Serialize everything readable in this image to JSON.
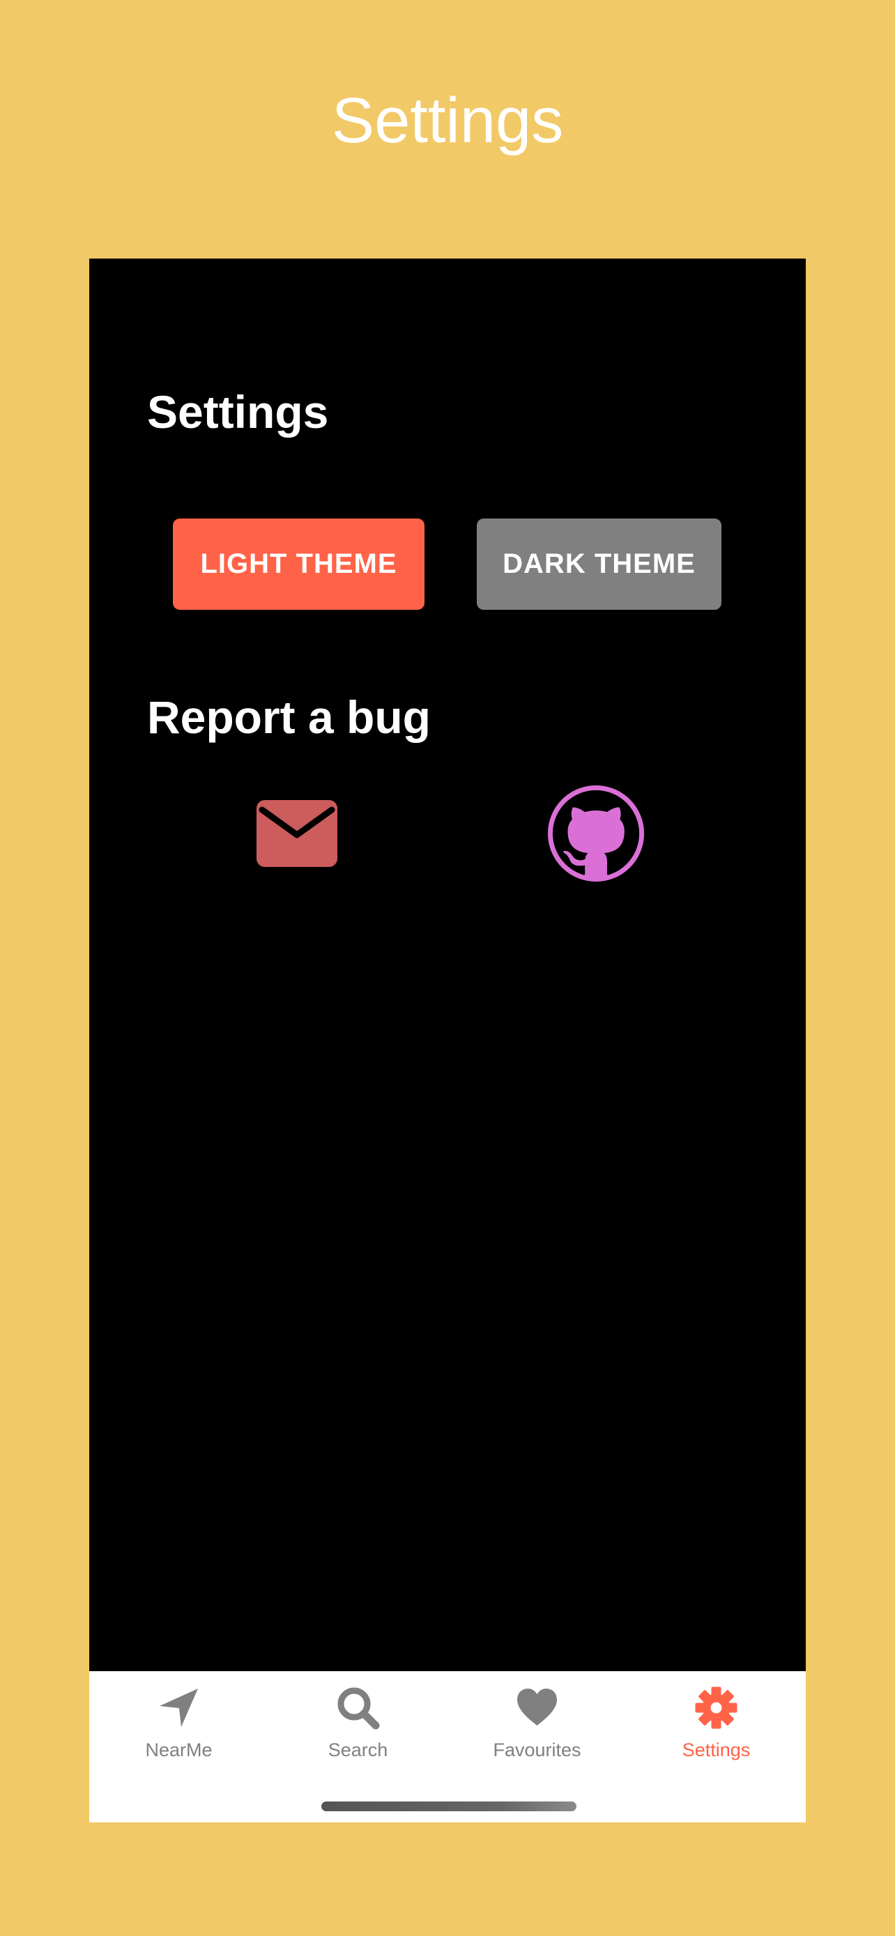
{
  "page_title": "Settings",
  "screen": {
    "heading": "Settings",
    "theme_buttons": {
      "light_label": "LIGHT THEME",
      "dark_label": "DARK THEME"
    },
    "report_heading": "Report a bug",
    "report_links": [
      {
        "icon": "mail-icon",
        "color": "#CD5C5C"
      },
      {
        "icon": "github-icon",
        "color": "#DA70D6"
      }
    ]
  },
  "tabbar": {
    "items": [
      {
        "label": "NearMe",
        "icon": "navigation-arrow-icon",
        "active": false
      },
      {
        "label": "Search",
        "icon": "search-icon",
        "active": false
      },
      {
        "label": "Favourites",
        "icon": "heart-icon",
        "active": false
      },
      {
        "label": "Settings",
        "icon": "gear-icon",
        "active": true
      }
    ]
  },
  "colors": {
    "outer_background": "#F2C967",
    "screen_background": "#000000",
    "accent": "#FF6347",
    "inactive": "#808080",
    "mail": "#CD5C5C",
    "github": "#DA70D6"
  }
}
